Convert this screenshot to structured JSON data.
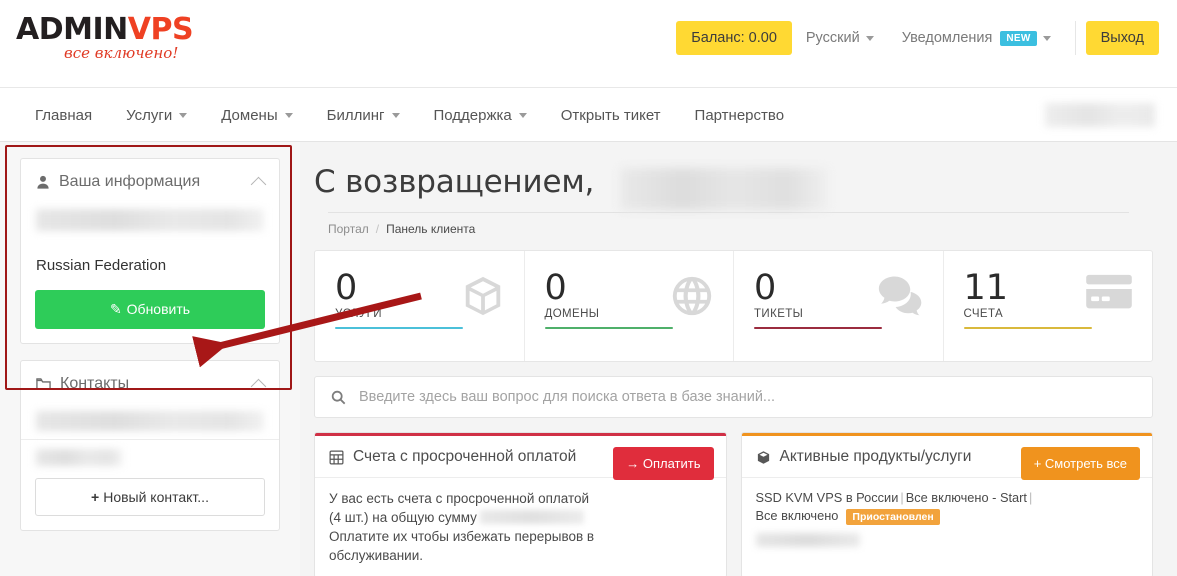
{
  "header": {
    "logo": {
      "name_dark": "ADMIN",
      "name_accent": "VPS",
      "tagline": "все включено!"
    },
    "balance_label": "Баланс: 0.00",
    "language_label": "Русский",
    "notifications_label": "Уведомления",
    "notifications_badge": "NEW",
    "logout_label": "Выход",
    "accent_yellow": "#ffd933",
    "badge_cyan": "#3bbfe0"
  },
  "nav": {
    "items": [
      {
        "label": "Главная",
        "has_caret": false
      },
      {
        "label": "Услуги",
        "has_caret": true
      },
      {
        "label": "Домены",
        "has_caret": true
      },
      {
        "label": "Биллинг",
        "has_caret": true
      },
      {
        "label": "Поддержка",
        "has_caret": true
      },
      {
        "label": "Открыть тикет",
        "has_caret": false
      },
      {
        "label": "Партнерство",
        "has_caret": false
      }
    ]
  },
  "sidebar": {
    "info_card": {
      "title": "Ваша информация",
      "icon": "user-icon",
      "country": "Russian Federation",
      "update_button": "Обновить"
    },
    "contacts_card": {
      "title": "Контакты",
      "icon": "folder-icon",
      "new_contact_button": "Новый контакт..."
    }
  },
  "main": {
    "greeting": "С возвращением,",
    "breadcrumb": {
      "root": "Портал",
      "separator": "/",
      "current": "Панель клиента"
    },
    "stats": [
      {
        "value": "0",
        "label": "Услуги",
        "color": "#4bc0d9",
        "icon": "box-icon"
      },
      {
        "value": "0",
        "label": "Домены",
        "color": "#4fb06a",
        "icon": "globe-icon"
      },
      {
        "value": "0",
        "label": "Тикеты",
        "color": "#9b2c3f",
        "icon": "chat-bubbles-icon"
      },
      {
        "value": "11",
        "label": "Счета",
        "color": "#d9b93c",
        "icon": "credit-card-icon"
      }
    ],
    "search": {
      "placeholder": "Введите здесь ваш вопрос для поиска ответа в базе знаний...",
      "icon": "search-icon",
      "value": ""
    },
    "overdue_panel": {
      "title": "Счета с просроченной оплатой",
      "icon": "invoice-grid-icon",
      "button_label": "Оплатить",
      "accent": "#d03046",
      "text_line1": "У вас есть счета с просроченной оплатой",
      "text_line2": "(4 шт.) на общую сумму",
      "text_line3": "Оплатите их чтобы избежать перерывов в",
      "text_line4": "обслуживании."
    },
    "products_panel": {
      "title": "Активные продукты/услуги",
      "icon": "box-icon",
      "button_label": "Смотреть все",
      "accent": "#f0931e",
      "product_part1": "SSD KVM VPS в России",
      "product_part2": "Все включено - Start",
      "product_part3": "Все включено",
      "status_badge": "Приостановлен"
    }
  },
  "annotations": {
    "highlight_color": "#a01818",
    "arrow_color": "#a81717"
  }
}
